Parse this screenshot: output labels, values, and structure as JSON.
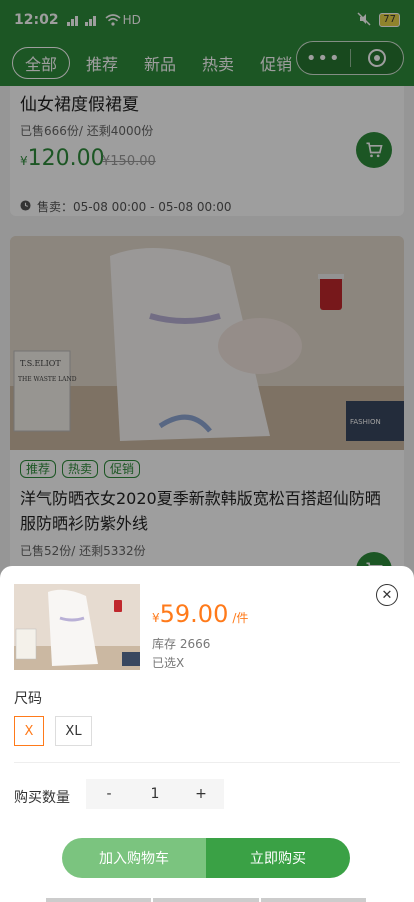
{
  "status_bar": {
    "time": "12:02",
    "network": "HD",
    "battery": "77"
  },
  "nav": {
    "tabs": [
      {
        "label": "全部",
        "active": true
      },
      {
        "label": "推荐",
        "active": false
      },
      {
        "label": "新品",
        "active": false
      },
      {
        "label": "热卖",
        "active": false
      },
      {
        "label": "促销",
        "active": false
      }
    ],
    "capsule_more": "•••"
  },
  "products": [
    {
      "title": "仙女裙度假裙夏",
      "sold": "已售666份/ 还剩4000份",
      "currency": "¥",
      "price": "120.00",
      "original_price": "¥150.00",
      "sale_time": "售卖：05-08 00:00 - 05-08 00:00"
    },
    {
      "tags": [
        "推荐",
        "热卖",
        "促销"
      ],
      "title": "洋气防晒衣女2020夏季新款韩版宽松百搭超仙防晒服防晒衫防紫外线",
      "sold": "已售52份/ 还剩5332份",
      "image_props": {
        "book_title": "T.S.ELIOT",
        "book_sub": "THE WASTE LAND",
        "box_text": "FASHION"
      }
    }
  ],
  "sheet": {
    "currency": "¥",
    "price": "59.00",
    "unit": "/件",
    "stock": "库存 2666",
    "selected": "已选X",
    "close_glyph": "✕",
    "size_label": "尺码",
    "sizes": [
      {
        "label": "X",
        "selected": true
      },
      {
        "label": "XL",
        "selected": false
      }
    ],
    "qty_label": "购买数量",
    "qty_minus": "-",
    "qty_value": "1",
    "qty_plus": "+",
    "add_cart": "加入购物车",
    "buy_now": "立即购买"
  },
  "colors": {
    "brand_green": "#2e8b3a",
    "price_orange": "#ff7a1a"
  }
}
